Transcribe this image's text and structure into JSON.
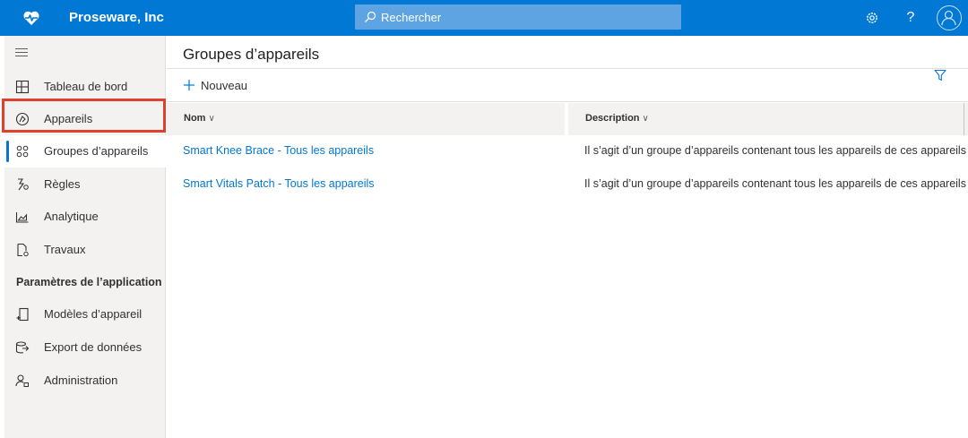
{
  "app": {
    "brand": "Proseware, Inc",
    "search_placeholder": "Rechercher"
  },
  "topbar": {
    "icons": [
      "settings-icon",
      "help-icon",
      "account-icon"
    ],
    "help_glyph": "?"
  },
  "sidebar": {
    "items": [
      {
        "label": "Tableau de bord",
        "icon": "dashboard-icon"
      },
      {
        "label": "Appareils",
        "icon": "devices-icon"
      },
      {
        "label": "Groupes d’appareils",
        "icon": "device-groups-icon",
        "selected": true
      },
      {
        "label": "Règles",
        "icon": "rules-icon"
      },
      {
        "label": "Analytique",
        "icon": "analytics-icon"
      },
      {
        "label": "Travaux",
        "icon": "jobs-icon"
      }
    ],
    "section_title": "Paramètres de l’application",
    "settings_items": [
      {
        "label": "Modèles d’appareil",
        "icon": "device-templates-icon"
      },
      {
        "label": "Export de données",
        "icon": "data-export-icon"
      },
      {
        "label": "Administration",
        "icon": "administration-icon"
      }
    ]
  },
  "main": {
    "title": "Groupes d’appareils",
    "new_label": "Nouveau",
    "columns": [
      {
        "label": "Nom"
      },
      {
        "label": "Description"
      }
    ],
    "rows": [
      {
        "name": "Smart Knee Brace - Tous les appareils",
        "description": "Il s’agit d’un groupe d’appareils contenant tous les appareils de ces appareils"
      },
      {
        "name": "Smart Vitals Patch - Tous les appareils",
        "description": "Il s’agit d’un groupe d’appareils contenant tous les appareils de ces appareils"
      }
    ]
  },
  "colors": {
    "brand_blue": "#0078d4",
    "highlight_red": "#e0412f",
    "sidebar_bg": "#f3f2f1"
  }
}
